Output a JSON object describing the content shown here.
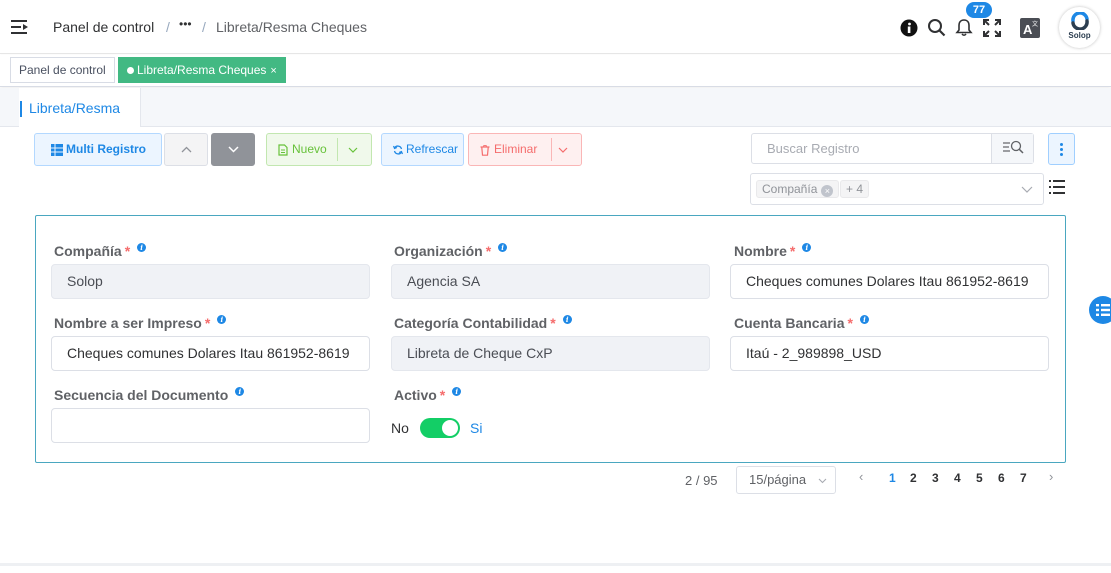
{
  "header": {
    "breadcrumb": [
      "Panel de control",
      "•••",
      "Libreta/Resma Cheques"
    ],
    "separator": "/",
    "notification_count": "77",
    "logo_text": "Solop",
    "icons": [
      "menu-icon",
      "info-icon",
      "search-icon",
      "bell-icon",
      "fullscreen-icon",
      "translate-icon"
    ]
  },
  "tags": [
    {
      "label": "Panel de control",
      "active": false
    },
    {
      "label": "Libreta/Resma Cheques",
      "active": true,
      "close": "×"
    }
  ],
  "tabs": [
    {
      "label": "Libreta/Resma"
    }
  ],
  "toolbar": {
    "multi_label": "Multi Registro",
    "new_label": "Nuevo",
    "refresh_label": "Refrescar",
    "delete_label": "Eliminar",
    "search_placeholder": "Buscar Registro",
    "filter_chip": "Compañía",
    "filter_more": "+ 4"
  },
  "form": {
    "fields": [
      {
        "label": "Compañía",
        "required": true,
        "value": "Solop",
        "disabled": true
      },
      {
        "label": "Organización",
        "required": true,
        "value": "Agencia SA",
        "disabled": true
      },
      {
        "label": "Nombre",
        "required": true,
        "value": "Cheques comunes Dolares Itau 861952-8619",
        "disabled": false
      },
      {
        "label": "Nombre a ser Impreso",
        "required": true,
        "value": "Cheques comunes Dolares Itau 861952-8619",
        "disabled": false
      },
      {
        "label": "Categoría Contabilidad",
        "required": true,
        "value": "Libreta de Cheque CxP",
        "disabled": true
      },
      {
        "label": "Cuenta Bancaria",
        "required": true,
        "value": "Itaú - 2_989898_USD",
        "disabled": false
      },
      {
        "label": "Secuencia del Documento",
        "required": false,
        "value": "",
        "disabled": false
      },
      {
        "label": "Activo",
        "required": true
      }
    ],
    "required_mark": "*",
    "switch_off": "No",
    "switch_on": "Si",
    "active_on": true
  },
  "pagination": {
    "total": "2 / 95",
    "page_size": "15/página",
    "pages": [
      "1",
      "2",
      "3",
      "4",
      "5",
      "6",
      "7"
    ],
    "current": "1",
    "prev": "‹",
    "next": "›"
  },
  "colors": {
    "primary": "#1e88e5",
    "success": "#13ce66",
    "danger": "#f56c6c",
    "tag_active": "#42b983"
  }
}
